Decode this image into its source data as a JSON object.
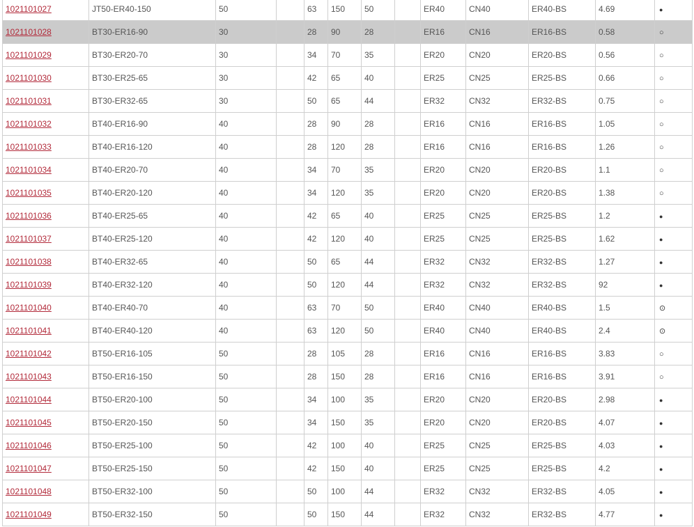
{
  "rows": [
    {
      "code": "1021101027",
      "model": "JT50-ER40-150",
      "taper": "50",
      "c4": "",
      "d": "63",
      "l": "150",
      "d2": "50",
      "c8": "",
      "collet": "ER40",
      "nut": "CN40",
      "wrench": "ER40-BS",
      "weight": "4.69",
      "stock": "filled-dot"
    },
    {
      "code": "1021101028",
      "model": "BT30-ER16-90",
      "taper": "30",
      "c4": "",
      "d": "28",
      "l": "90",
      "d2": "28",
      "c8": "",
      "collet": "ER16",
      "nut": "CN16",
      "wrench": "ER16-BS",
      "weight": "0.58",
      "stock": "open-circle",
      "highlight": true
    },
    {
      "code": "1021101029",
      "model": "BT30-ER20-70",
      "taper": "30",
      "c4": "",
      "d": "34",
      "l": "70",
      "d2": "35",
      "c8": "",
      "collet": "ER20",
      "nut": "CN20",
      "wrench": "ER20-BS",
      "weight": "0.56",
      "stock": "open-circle"
    },
    {
      "code": "1021101030",
      "model": "BT30-ER25-65",
      "taper": "30",
      "c4": "",
      "d": "42",
      "l": "65",
      "d2": "40",
      "c8": "",
      "collet": "ER25",
      "nut": "CN25",
      "wrench": "ER25-BS",
      "weight": "0.66",
      "stock": "open-circle"
    },
    {
      "code": "1021101031",
      "model": "BT30-ER32-65",
      "taper": "30",
      "c4": "",
      "d": "50",
      "l": "65",
      "d2": "44",
      "c8": "",
      "collet": "ER32",
      "nut": "CN32",
      "wrench": "ER32-BS",
      "weight": "0.75",
      "stock": "open-circle"
    },
    {
      "code": "1021101032",
      "model": "BT40-ER16-90",
      "taper": "40",
      "c4": "",
      "d": "28",
      "l": "90",
      "d2": "28",
      "c8": "",
      "collet": "ER16",
      "nut": "CN16",
      "wrench": "ER16-BS",
      "weight": "1.05",
      "stock": "open-circle"
    },
    {
      "code": "1021101033",
      "model": "BT40-ER16-120",
      "taper": "40",
      "c4": "",
      "d": "28",
      "l": "120",
      "d2": "28",
      "c8": "",
      "collet": "ER16",
      "nut": "CN16",
      "wrench": "ER16-BS",
      "weight": "1.26",
      "stock": "open-circle"
    },
    {
      "code": "1021101034",
      "model": "BT40-ER20-70",
      "taper": "40",
      "c4": "",
      "d": "34",
      "l": "70",
      "d2": "35",
      "c8": "",
      "collet": "ER20",
      "nut": "CN20",
      "wrench": "ER20-BS",
      "weight": "1.1",
      "stock": "open-circle"
    },
    {
      "code": "1021101035",
      "model": "BT40-ER20-120",
      "taper": "40",
      "c4": "",
      "d": "34",
      "l": "120",
      "d2": "35",
      "c8": "",
      "collet": "ER20",
      "nut": "CN20",
      "wrench": "ER20-BS",
      "weight": "1.38",
      "stock": "open-circle"
    },
    {
      "code": "1021101036",
      "model": "BT40-ER25-65",
      "taper": "40",
      "c4": "",
      "d": "42",
      "l": "65",
      "d2": "40",
      "c8": "",
      "collet": "ER25",
      "nut": "CN25",
      "wrench": "ER25-BS",
      "weight": "1.2",
      "stock": "filled-dot"
    },
    {
      "code": "1021101037",
      "model": "BT40-ER25-120",
      "taper": "40",
      "c4": "",
      "d": "42",
      "l": "120",
      "d2": "40",
      "c8": "",
      "collet": "ER25",
      "nut": "CN25",
      "wrench": "ER25-BS",
      "weight": "1.62",
      "stock": "filled-dot"
    },
    {
      "code": "1021101038",
      "model": "BT40-ER32-65",
      "taper": "40",
      "c4": "",
      "d": "50",
      "l": "65",
      "d2": "44",
      "c8": "",
      "collet": "ER32",
      "nut": "CN32",
      "wrench": "ER32-BS",
      "weight": "1.27",
      "stock": "filled-dot"
    },
    {
      "code": "1021101039",
      "model": "BT40-ER32-120",
      "taper": "40",
      "c4": "",
      "d": "50",
      "l": "120",
      "d2": "44",
      "c8": "",
      "collet": "ER32",
      "nut": "CN32",
      "wrench": "ER32-BS",
      "weight": "92",
      "stock": "filled-dot"
    },
    {
      "code": "1021101040",
      "model": "BT40-ER40-70",
      "taper": "40",
      "c4": "",
      "d": "63",
      "l": "70",
      "d2": "50",
      "c8": "",
      "collet": "ER40",
      "nut": "CN40",
      "wrench": "ER40-BS",
      "weight": "1.5",
      "stock": "dotted-circle"
    },
    {
      "code": "1021101041",
      "model": "BT40-ER40-120",
      "taper": "40",
      "c4": "",
      "d": "63",
      "l": "120",
      "d2": "50",
      "c8": "",
      "collet": "ER40",
      "nut": "CN40",
      "wrench": "ER40-BS",
      "weight": "2.4",
      "stock": "dotted-circle"
    },
    {
      "code": "1021101042",
      "model": "BT50-ER16-105",
      "taper": "50",
      "c4": "",
      "d": "28",
      "l": "105",
      "d2": "28",
      "c8": "",
      "collet": "ER16",
      "nut": "CN16",
      "wrench": "ER16-BS",
      "weight": "3.83",
      "stock": "open-circle"
    },
    {
      "code": "1021101043",
      "model": "BT50-ER16-150",
      "taper": "50",
      "c4": "",
      "d": "28",
      "l": "150",
      "d2": "28",
      "c8": "",
      "collet": "ER16",
      "nut": "CN16",
      "wrench": "ER16-BS",
      "weight": "3.91",
      "stock": "open-circle"
    },
    {
      "code": "1021101044",
      "model": "BT50-ER20-100",
      "taper": "50",
      "c4": "",
      "d": "34",
      "l": "100",
      "d2": "35",
      "c8": "",
      "collet": "ER20",
      "nut": "CN20",
      "wrench": "ER20-BS",
      "weight": "2.98",
      "stock": "filled-dot"
    },
    {
      "code": "1021101045",
      "model": "BT50-ER20-150",
      "taper": "50",
      "c4": "",
      "d": "34",
      "l": "150",
      "d2": "35",
      "c8": "",
      "collet": "ER20",
      "nut": "CN20",
      "wrench": "ER20-BS",
      "weight": "4.07",
      "stock": "filled-dot"
    },
    {
      "code": "1021101046",
      "model": "BT50-ER25-100",
      "taper": "50",
      "c4": "",
      "d": "42",
      "l": "100",
      "d2": "40",
      "c8": "",
      "collet": "ER25",
      "nut": "CN25",
      "wrench": "ER25-BS",
      "weight": "4.03",
      "stock": "filled-dot"
    },
    {
      "code": "1021101047",
      "model": "BT50-ER25-150",
      "taper": "50",
      "c4": "",
      "d": "42",
      "l": "150",
      "d2": "40",
      "c8": "",
      "collet": "ER25",
      "nut": "CN25",
      "wrench": "ER25-BS",
      "weight": "4.2",
      "stock": "filled-dot"
    },
    {
      "code": "1021101048",
      "model": "BT50-ER32-100",
      "taper": "50",
      "c4": "",
      "d": "50",
      "l": "100",
      "d2": "44",
      "c8": "",
      "collet": "ER32",
      "nut": "CN32",
      "wrench": "ER32-BS",
      "weight": "4.05",
      "stock": "filled-dot"
    },
    {
      "code": "1021101049",
      "model": "BT50-ER32-150",
      "taper": "50",
      "c4": "",
      "d": "50",
      "l": "150",
      "d2": "44",
      "c8": "",
      "collet": "ER32",
      "nut": "CN32",
      "wrench": "ER32-BS",
      "weight": "4.77",
      "stock": "filled-dot"
    }
  ],
  "colors": {
    "link": "#b22a3a",
    "highlight_row": "#cbcbcb",
    "border": "#cfcfcf",
    "text": "#555555"
  }
}
